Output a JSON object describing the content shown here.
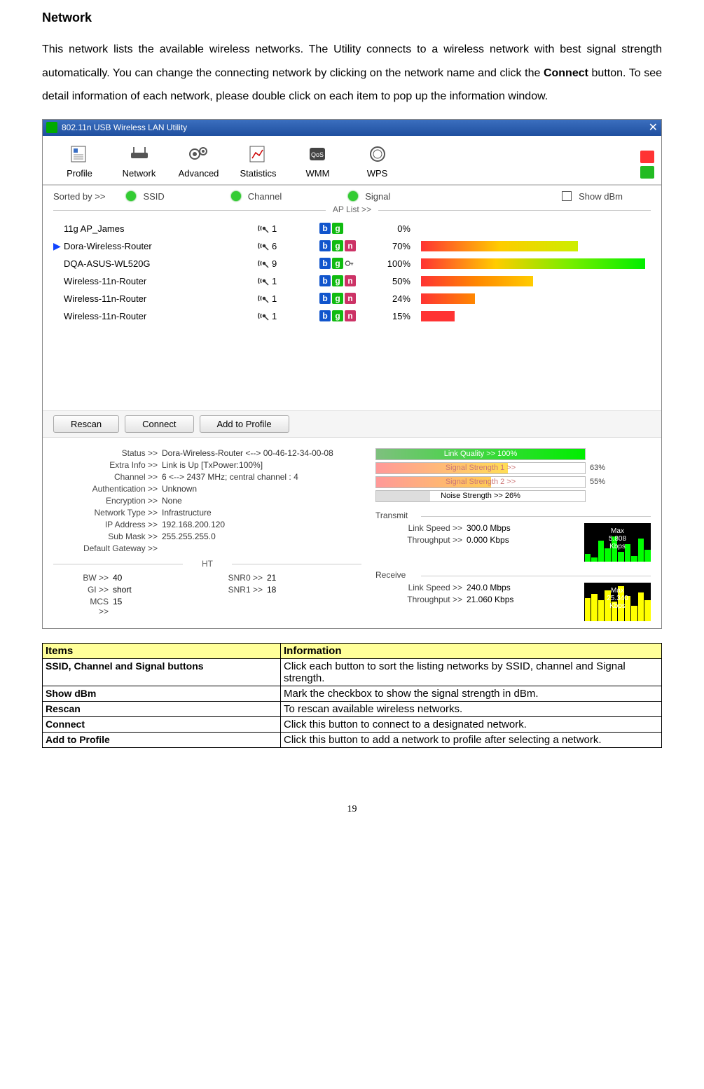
{
  "doc": {
    "title": "Network",
    "intro_before": "This network lists the available wireless networks. The Utility connects to a wireless network with best signal strength automatically. You can change the connecting network by clicking on the network name and click the ",
    "intro_bold": "Connect",
    "intro_after": " button. To see detail information of each network, please double click on each item to pop up the information window."
  },
  "app": {
    "window_title": "802.11n USB Wireless LAN Utility",
    "tabs": {
      "profile": "Profile",
      "network": "Network",
      "advanced": "Advanced",
      "statistics": "Statistics",
      "wmm": "WMM",
      "wps": "WPS"
    },
    "sort": {
      "label": "Sorted by >>",
      "ssid": "SSID",
      "channel": "Channel",
      "signal": "Signal",
      "show_dbm": "Show dBm"
    },
    "ap_list_label": "AP List >>",
    "ap_list": [
      {
        "ssid": "11g AP_James",
        "channel": "1",
        "modes": [
          "b",
          "g"
        ],
        "secure": false,
        "signal": "0%",
        "pct": 0,
        "selected": false
      },
      {
        "ssid": "Dora-Wireless-Router",
        "channel": "6",
        "modes": [
          "b",
          "g",
          "n"
        ],
        "secure": false,
        "signal": "70%",
        "pct": 70,
        "selected": true
      },
      {
        "ssid": "DQA-ASUS-WL520G",
        "channel": "9",
        "modes": [
          "b",
          "g"
        ],
        "secure": true,
        "signal": "100%",
        "pct": 100,
        "selected": false
      },
      {
        "ssid": "Wireless-11n-Router",
        "channel": "1",
        "modes": [
          "b",
          "g",
          "n"
        ],
        "secure": false,
        "signal": "50%",
        "pct": 50,
        "selected": false
      },
      {
        "ssid": "Wireless-11n-Router",
        "channel": "1",
        "modes": [
          "b",
          "g",
          "n"
        ],
        "secure": false,
        "signal": "24%",
        "pct": 24,
        "selected": false
      },
      {
        "ssid": "Wireless-11n-Router",
        "channel": "1",
        "modes": [
          "b",
          "g",
          "n"
        ],
        "secure": false,
        "signal": "15%",
        "pct": 15,
        "selected": false
      }
    ],
    "buttons": {
      "rescan": "Rescan",
      "connect": "Connect",
      "add": "Add to Profile"
    },
    "status": {
      "status_k": "Status >>",
      "status_v": "Dora-Wireless-Router <--> 00-46-12-34-00-08",
      "extra_k": "Extra Info >>",
      "extra_v": "Link is Up [TxPower:100%]",
      "channel_k": "Channel >>",
      "channel_v": "6 <--> 2437 MHz; central channel : 4",
      "auth_k": "Authentication >>",
      "auth_v": "Unknown",
      "enc_k": "Encryption >>",
      "enc_v": "None",
      "nettype_k": "Network Type >>",
      "nettype_v": "Infrastructure",
      "ip_k": "IP Address >>",
      "ip_v": "192.168.200.120",
      "mask_k": "Sub Mask >>",
      "mask_v": "255.255.255.0",
      "gw_k": "Default Gateway >>",
      "gw_v": ""
    },
    "ht": {
      "title": "HT",
      "bw_k": "BW >>",
      "bw_v": "40",
      "gi_k": "GI >>",
      "gi_v": "short",
      "mcs_k": "MCS >>",
      "mcs_v": "15",
      "snr0_k": "SNR0 >>",
      "snr0_v": "21",
      "snr1_k": "SNR1 >>",
      "snr1_v": "18"
    },
    "meters": {
      "link_quality": "Link Quality >> 100%",
      "signal1": "Signal Strength 1 >>",
      "signal1_extra": "63%",
      "signal2": "Signal Strength 2 >>",
      "signal2_extra": "55%",
      "noise": "Noise Strength >> 26%"
    },
    "transmit": {
      "title": "Transmit",
      "speed_k": "Link Speed >>",
      "speed_v": "300.0 Mbps",
      "tp_k": "Throughput >>",
      "tp_v": "0.000 Kbps",
      "max_label": "Max",
      "max_val": "5.808",
      "max_unit": "Kbps"
    },
    "receive": {
      "title": "Receive",
      "speed_k": "Link Speed >>",
      "speed_v": "240.0 Mbps",
      "tp_k": "Throughput >>",
      "tp_v": "21.060 Kbps",
      "max_label": "Max",
      "max_val": "25.340",
      "max_unit": "Kbps"
    }
  },
  "table": {
    "h1": "Items",
    "h2": "Information",
    "rows": [
      {
        "item": "SSID, Channel and Signal buttons",
        "info": "Click each button to sort the listing networks by SSID, channel and Signal strength."
      },
      {
        "item": "Show dBm",
        "info": "Mark the checkbox to show the signal strength in dBm."
      },
      {
        "item": "Rescan",
        "info": "To rescan available wireless networks."
      },
      {
        "item": "Connect",
        "info": "Click this button to connect to a designated network."
      },
      {
        "item": "Add to Profile",
        "info": "Click this button to add a network to profile after selecting a network."
      }
    ]
  },
  "page_number": "19"
}
